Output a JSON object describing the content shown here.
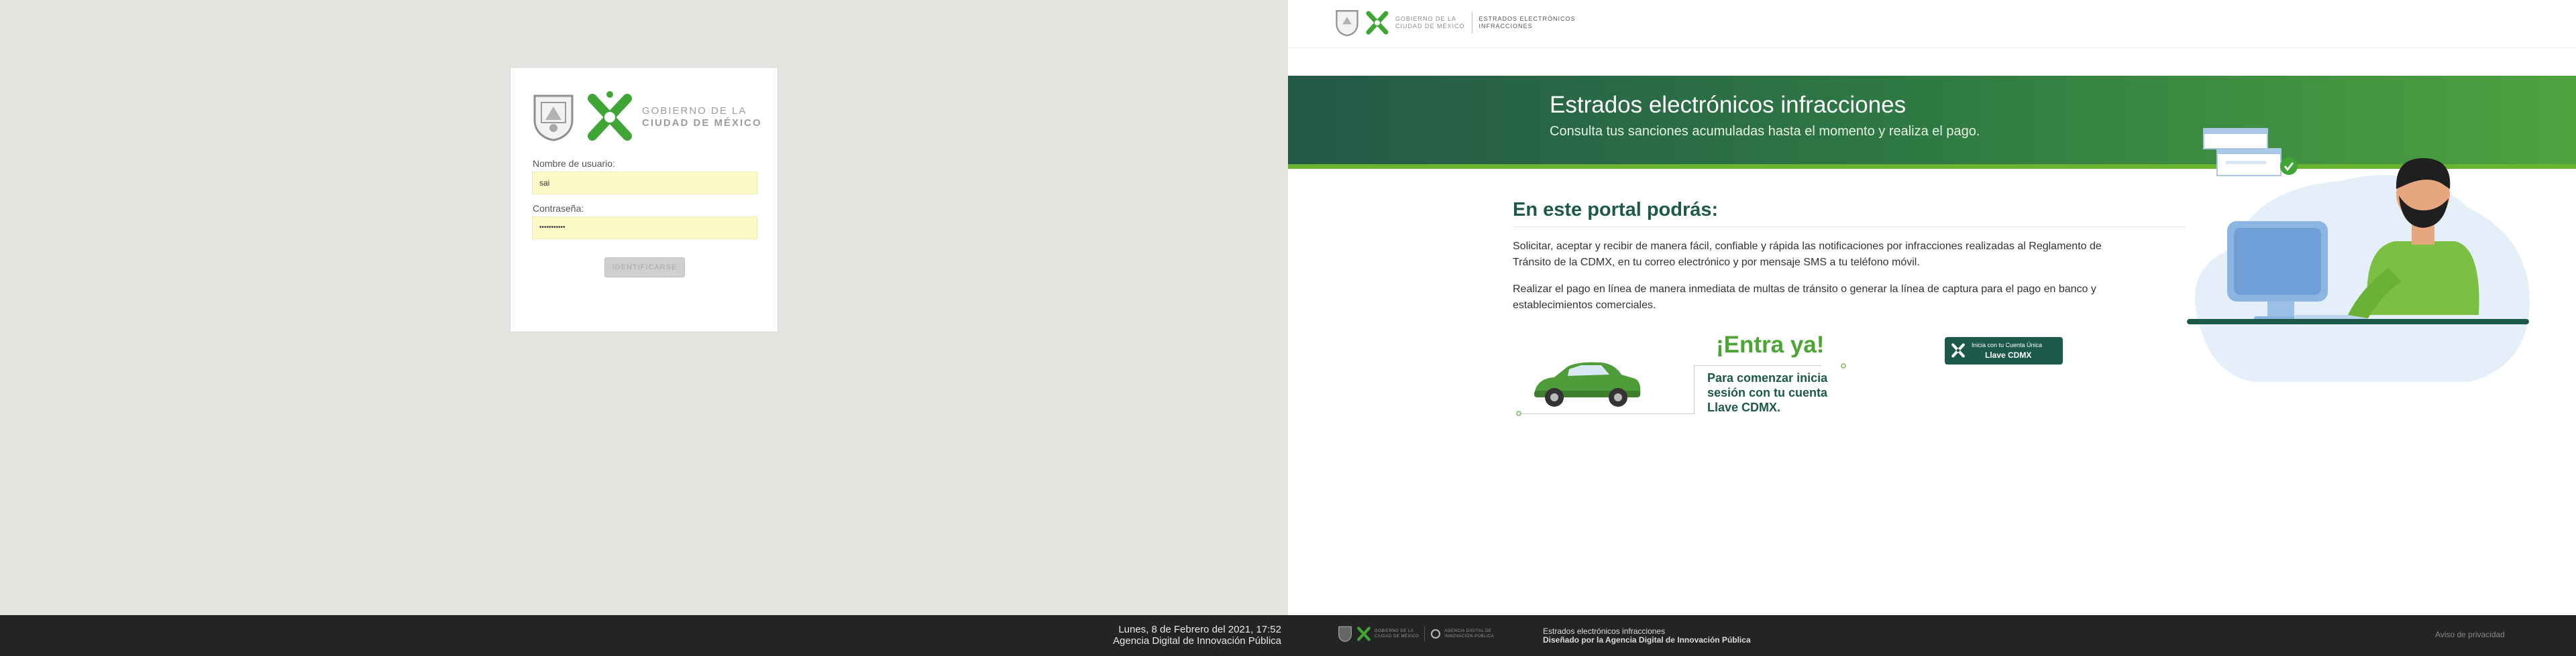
{
  "left": {
    "login": {
      "gov_line1": "GOBIERNO DE LA",
      "gov_line2": "CIUDAD DE MÉXICO",
      "username_label": "Nombre de usuario:",
      "username_value": "sai",
      "password_label": "Contraseña:",
      "password_value": "•••••••••••",
      "submit_label": "IDENTIFICARSE"
    },
    "status": {
      "line1": "Lunes, 8 de Febrero del 2021, 17:52",
      "line2": "Agencia Digital de Innovación Pública"
    }
  },
  "right": {
    "topbar": {
      "gov_line1": "GOBIERNO DE LA",
      "gov_line2": "CIUDAD DE MÉXICO",
      "portal_line1": "ESTRADOS ELECTRÓNICOS",
      "portal_line2": "INFRACCIONES"
    },
    "hero": {
      "title": "Estrados electrónicos infracciones",
      "subtitle": "Consulta tus sanciones acumuladas hasta el momento y realiza el pago."
    },
    "main": {
      "section_title": "En este portal podrás:",
      "paragraph1": "Solicitar, aceptar y recibir de manera fácil, confiable y rápida las notificaciones por infracciones realizadas al Reglamento de Tránsito de la CDMX, en tu correo electrónico y por mensaje SMS a tu teléfono móvil.",
      "paragraph2": "Realizar el pago en línea de manera inmediata de multas de tránsito o generar la línea de captura para el pago en banco y establecimientos comerciales.",
      "cta_title": "¡Entra ya!",
      "cta_sub": "Para comenzar inicia sesión con tu cuenta Llave CDMX.",
      "llave_line1": "Inicia con tu Cuenta Única",
      "llave_line2": "Llave CDMX"
    },
    "footer": {
      "gov_line1": "GOBIERNO DE LA",
      "gov_line2": "CIUDAD DE MÉXICO",
      "agency_line1": "AGENCIA DIGITAL DE",
      "agency_line2": "INNOVACIÓN PÚBLICA",
      "portal_line1": "Estrados electrónicos infracciones",
      "portal_line2": "Diseñado por la Agencia Digital de Innovación Pública",
      "privacy": "Aviso de privacidad"
    }
  },
  "colors": {
    "brand_dark": "#1d5948",
    "brand_green": "#4ca534",
    "status_bg": "#242424",
    "left_bg": "#e5e4e1"
  }
}
